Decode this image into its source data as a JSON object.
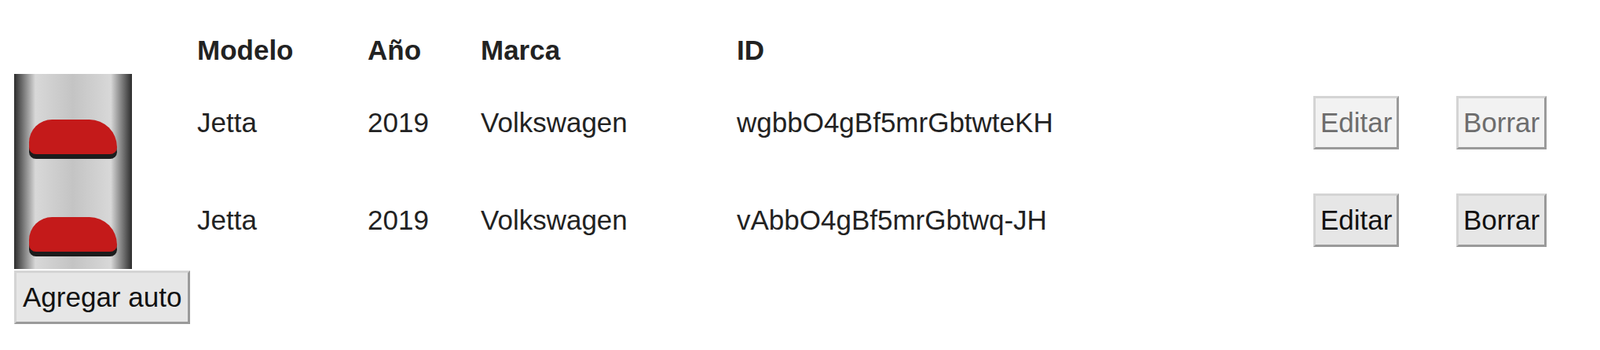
{
  "table": {
    "columns": [
      "Modelo",
      "Año",
      "Marca",
      "ID"
    ],
    "rows": [
      {
        "modelo": "Jetta",
        "anio": "2019",
        "marca": "Volkswagen",
        "id": "wgbbO4gBf5mrGbtwteKH",
        "actions": [
          {
            "label": "Editar",
            "disabled": true
          },
          {
            "label": "Borrar",
            "disabled": true
          }
        ]
      },
      {
        "modelo": "Jetta",
        "anio": "2019",
        "marca": "Volkswagen",
        "id": "vAbbO4gBf5mrGbtwq-JH",
        "actions": [
          {
            "label": "Editar",
            "disabled": false
          },
          {
            "label": "Borrar",
            "disabled": false
          }
        ]
      }
    ]
  },
  "add_button": {
    "label": "Agregar auto"
  }
}
